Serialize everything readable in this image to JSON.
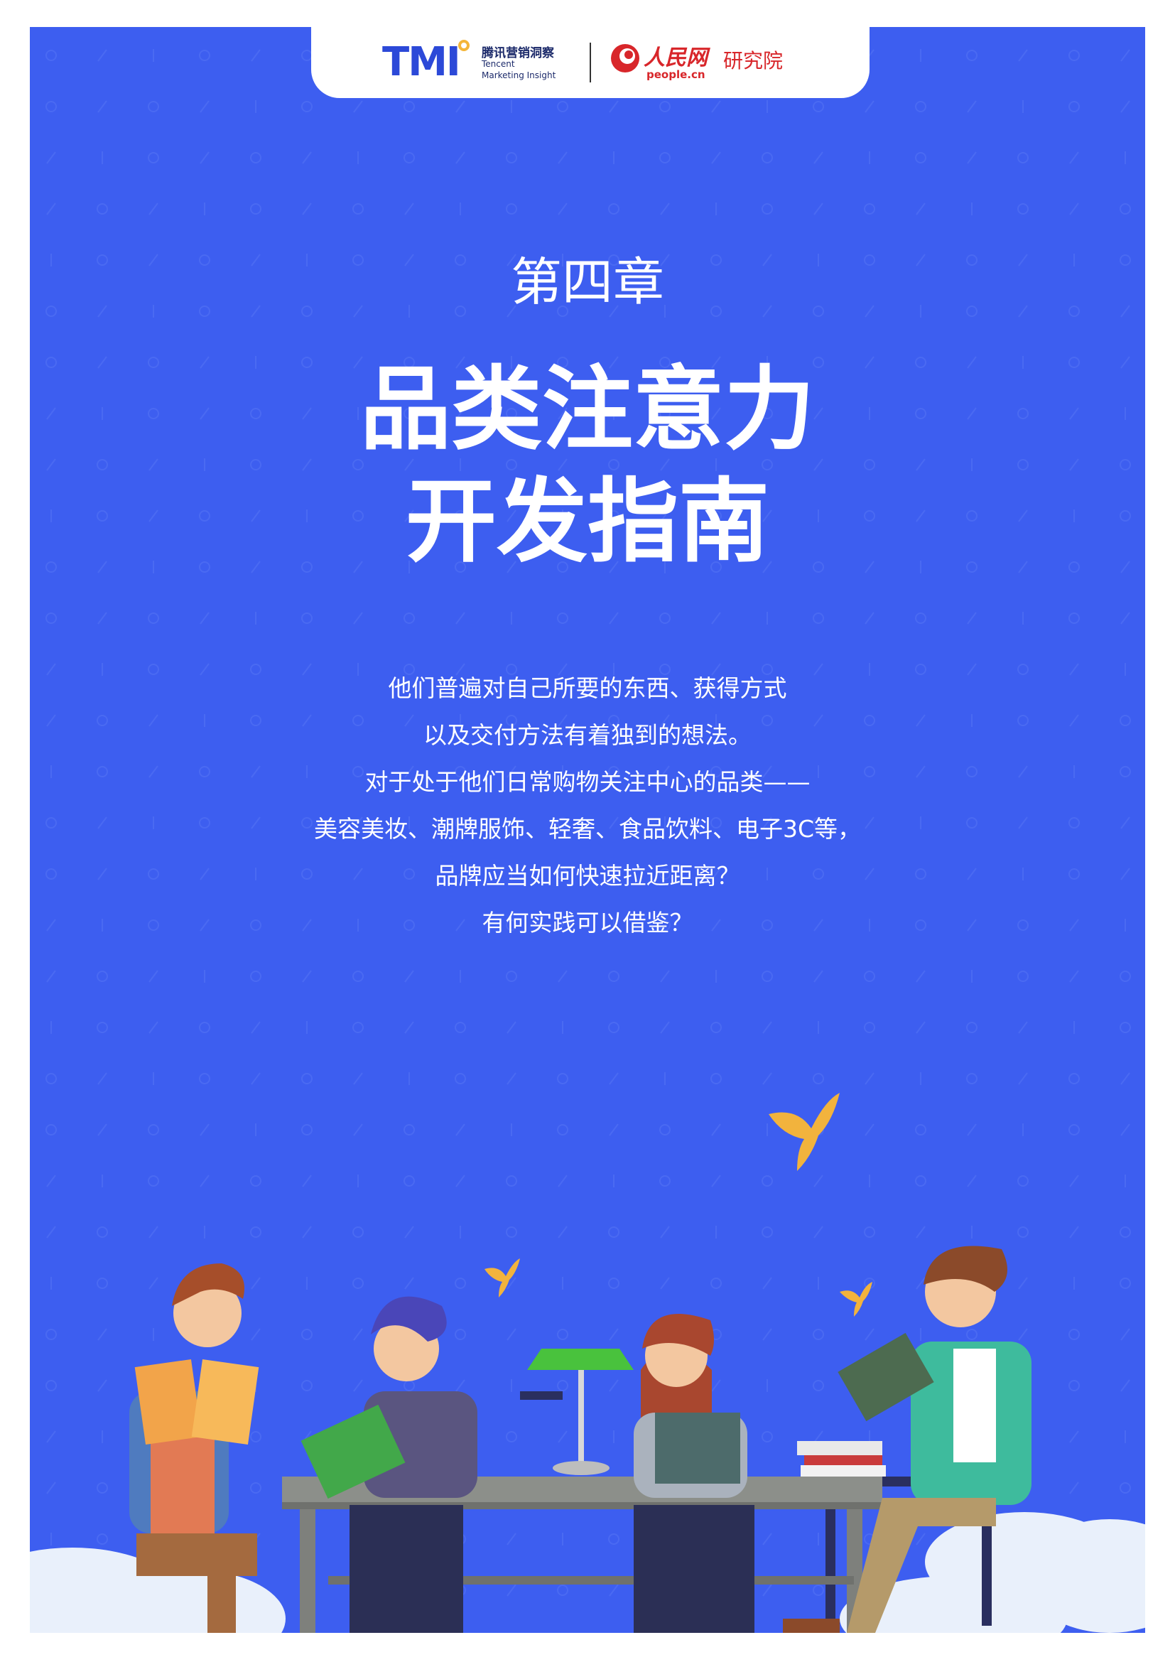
{
  "header": {
    "tmi_logo_text": "TMI",
    "tmi_name_cn": "腾讯营销洞察",
    "tmi_name_en_line1": "Tencent",
    "tmi_name_en_line2": "Marketing Insight",
    "people_logo_cn": "人民网",
    "people_logo_domain": "people.cn",
    "people_institute": "研究院"
  },
  "chapter_label": "第四章",
  "title_lines": [
    "品类注意力",
    "开发指南"
  ],
  "intro_lines": [
    "他们普遍对自己所要的东西、获得方式",
    "以及交付方法有着独到的想法。",
    "对于处于他们日常购物关注中心的品类——",
    "美容美妆、潮牌服饰、轻奢、食品饮料、电子3C等，",
    "品牌应当如何快速拉近距离？",
    "有何实践可以借鉴？"
  ],
  "colors": {
    "page_background": "#3d5ef0",
    "tmi_blue": "#2c49d8",
    "people_red": "#d8262a",
    "bird_gold": "#f2b33d"
  },
  "illustration": {
    "description_icons": [
      "swallow-icon",
      "desk-lamp-icon",
      "reader-figure",
      "cloud-shape",
      "book-icon"
    ]
  }
}
